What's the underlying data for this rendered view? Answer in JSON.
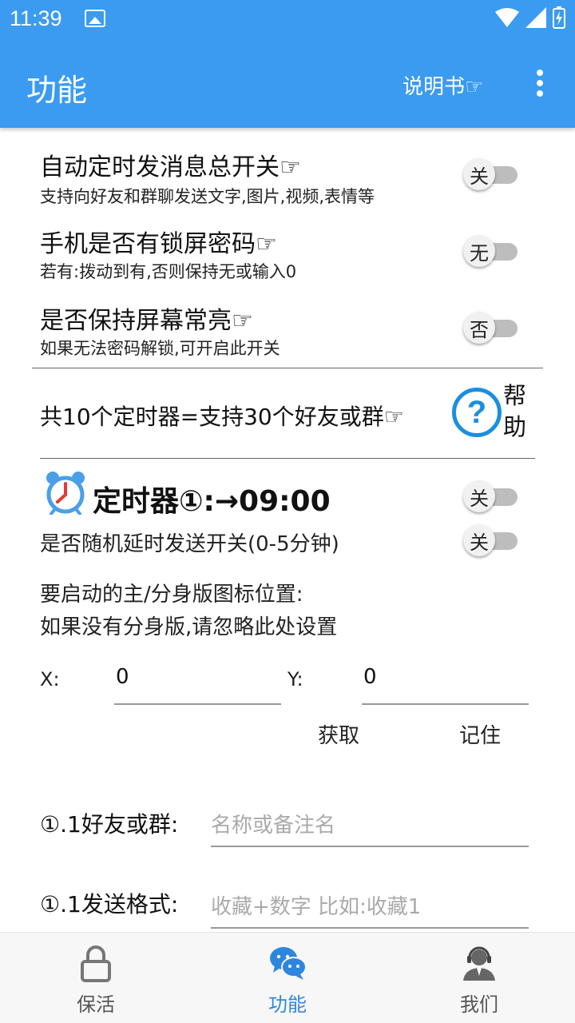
{
  "status_bar": {
    "time": "11:39"
  },
  "app_bar": {
    "title": "功能",
    "manual_link": "说明书☞"
  },
  "settings": [
    {
      "title": "自动定时发消息总开关☞",
      "subtitle": "支持向好友和群聊发送文字,图片,视频,表情等",
      "toggle_label": "关"
    },
    {
      "title": "手机是否有锁屏密码☞",
      "subtitle": "若有:拨动到有,否则保持无或输入0",
      "toggle_label": "无"
    },
    {
      "title": "是否保持屏幕常亮☞",
      "subtitle": "如果无法密码解锁,可开启此开关",
      "toggle_label": "否"
    }
  ],
  "timer_info": {
    "text": "共10个定时器=支持30个好友或群☞",
    "help_label": "帮助"
  },
  "timer": {
    "header": "定时器①:→09:00",
    "toggle_label": "关",
    "random_delay_label": "是否随机延时发送开关(0-5分钟)",
    "random_delay_toggle_label": "关",
    "icon_position_line1": "要启动的主/分身版图标位置:",
    "icon_position_line2": "如果没有分身版,请忽略此处设置",
    "x_label": "X:",
    "x_value": "0",
    "y_label": "Y:",
    "y_value": "0",
    "get_button": "获取",
    "remember_button": "记住",
    "friend_label": "①.1好友或群:",
    "friend_placeholder": "名称或备注名",
    "format_label": "①.1发送格式:",
    "format_placeholder": "收藏+数字 比如:收藏1"
  },
  "bottom_nav": [
    {
      "label": "保活",
      "icon": "lock-icon",
      "active": false
    },
    {
      "label": "功能",
      "icon": "chat-bubbles-icon",
      "active": true
    },
    {
      "label": "我们",
      "icon": "support-agent-icon",
      "active": false
    }
  ],
  "colors": {
    "primary": "#3a9bf0",
    "accent": "#1a8fe0",
    "active_tab": "#2e86de"
  }
}
